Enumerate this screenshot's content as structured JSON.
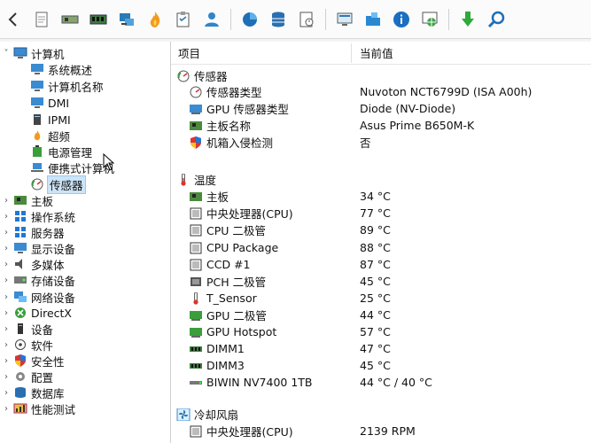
{
  "toolbar": {
    "icons": [
      "back-icon",
      "document-icon",
      "motherboard-icon",
      "memory-icon",
      "network-computer-icon",
      "fire-icon",
      "clipboard-icon",
      "user-icon",
      "chart-icon",
      "database-icon",
      "report-icon",
      "monitor-icon",
      "folder-network-icon",
      "info-icon",
      "globe-network-icon",
      "download-icon",
      "search-icon"
    ]
  },
  "sidebar": {
    "root": {
      "label": "计算机"
    },
    "children": [
      {
        "label": "系统概述"
      },
      {
        "label": "计算机名称"
      },
      {
        "label": "DMI"
      },
      {
        "label": "IPMI"
      },
      {
        "label": "超频"
      },
      {
        "label": "电源管理"
      },
      {
        "label": "便携式计算机"
      },
      {
        "label": "传感器"
      }
    ],
    "top_level": [
      {
        "label": "主板"
      },
      {
        "label": "操作系统"
      },
      {
        "label": "服务器"
      },
      {
        "label": "显示设备"
      },
      {
        "label": "多媒体"
      },
      {
        "label": "存储设备"
      },
      {
        "label": "网络设备"
      },
      {
        "label": "DirectX"
      },
      {
        "label": "设备"
      },
      {
        "label": "软件"
      },
      {
        "label": "安全性"
      },
      {
        "label": "配置"
      },
      {
        "label": "数据库"
      },
      {
        "label": "性能测试"
      }
    ]
  },
  "main": {
    "headers": {
      "item": "项目",
      "value": "当前值"
    },
    "sections": {
      "sensor": {
        "title": "传感器",
        "rows": [
          {
            "label": "传感器类型",
            "value": "Nuvoton NCT6799D  (ISA A00h)"
          },
          {
            "label": "GPU 传感器类型",
            "value": "Diode  (NV-Diode)"
          },
          {
            "label": "主板名称",
            "value": "Asus Prime B650M-K"
          },
          {
            "label": "机箱入侵检测",
            "value": "否"
          }
        ]
      },
      "temp": {
        "title": "温度",
        "rows": [
          {
            "label": "主板",
            "value": "34 °C"
          },
          {
            "label": "中央处理器(CPU)",
            "value": "77 °C"
          },
          {
            "label": "CPU 二极管",
            "value": "89 °C"
          },
          {
            "label": "CPU Package",
            "value": "88 °C"
          },
          {
            "label": "CCD #1",
            "value": "87 °C"
          },
          {
            "label": "PCH 二极管",
            "value": "45 °C"
          },
          {
            "label": "T_Sensor",
            "value": "25 °C"
          },
          {
            "label": "GPU 二极管",
            "value": "44 °C"
          },
          {
            "label": "GPU Hotspot",
            "value": "57 °C"
          },
          {
            "label": "DIMM1",
            "value": "47 °C"
          },
          {
            "label": "DIMM3",
            "value": "45 °C"
          },
          {
            "label": "BIWIN NV7400 1TB",
            "value": "44 °C / 40 °C"
          }
        ]
      },
      "fan": {
        "title": "冷却风扇",
        "rows": [
          {
            "label": "中央处理器(CPU)",
            "value": "2139 RPM"
          }
        ]
      }
    }
  },
  "colors": {
    "selection": "#cce4f7",
    "sidebar_bg": "#ffffff",
    "toolbar_bg": "#fbfbfb"
  }
}
